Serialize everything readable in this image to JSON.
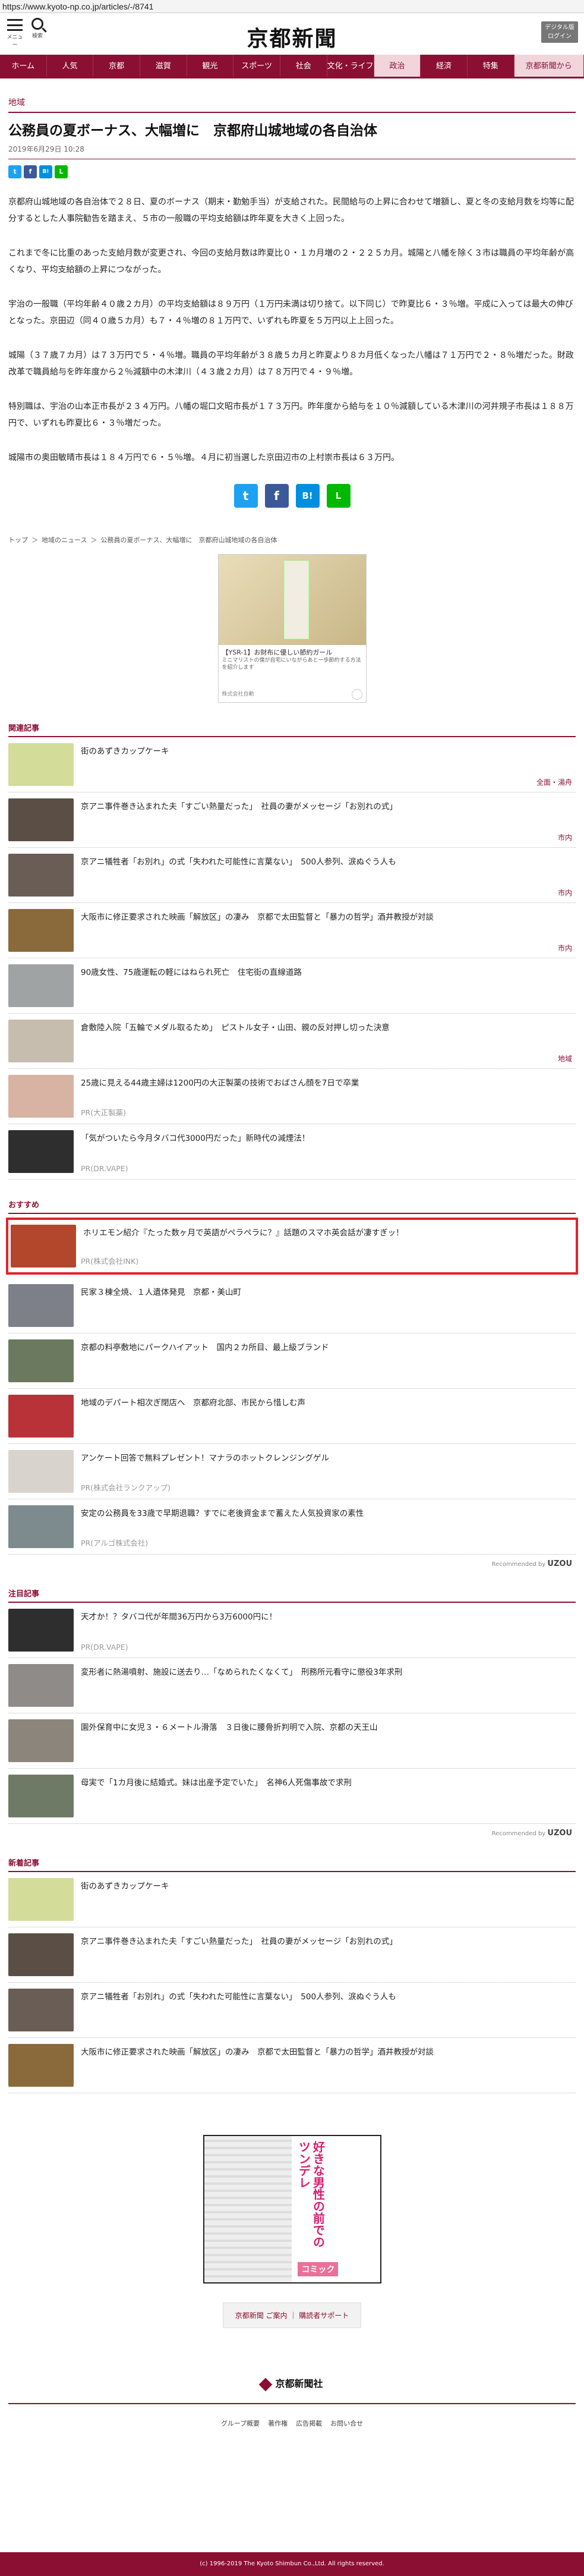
{
  "browser": {
    "url": "https://www.kyoto-np.co.jp/articles/-/8741"
  },
  "header": {
    "menu_label": "メニュー",
    "search_label": "検索",
    "logo": "京都新聞",
    "digital_btn": "デジタル版\nログイン"
  },
  "nav": {
    "items": [
      "ホーム",
      "人気",
      "京都",
      "滋賀",
      "観光",
      "スポーツ",
      "社会",
      "文化・ライフ",
      "政治",
      "経済",
      "特集",
      "京都新聞から"
    ],
    "selected_index": 8
  },
  "article": {
    "category": "地域",
    "title": "公務員の夏ボーナス、大幅増に　京都府山城地域の各自治体",
    "date": "2019年6月29日 10:28",
    "paragraphs": [
      "京都府山城地域の各自治体で２８日、夏のボーナス（期末・勤勉手当）が支給された。民間給与の上昇に合わせて増額し、夏と冬の支給月数を均等に配分するとした人事院勧告を踏まえ、５市の一般職の平均支給額は昨年夏を大きく上回った。",
      "これまで冬に比重のあった支給月数が変更され、今回の支給月数は昨夏比０・１カ月増の２・２２５カ月。城陽と八幡を除く３市は職員の平均年齢が高くなり、平均支給額の上昇につながった。",
      "宇治の一般職（平均年齢４０歳２カ月）の平均支給額は８９万円（１万円未満は切り捨て。以下同じ）で昨夏比６・３％増。平成に入っては最大の伸びとなった。京田辺（同４０歳５カ月）も７・４％増の８１万円で、いずれも昨夏を５万円以上上回った。",
      "城陽（３７歳７カ月）は７３万円で５・４％増。職員の平均年齢が３８歳５カ月と昨夏より８カ月低くなった八幡は７１万円で２・８％増だった。財政改革で職員給与を昨年度から２％減額中の木津川（４３歳２カ月）は７８万円で４・９％増。",
      "特別職は、宇治の山本正市長が２３４万円。八幡の堀口文昭市長が１７３万円。昨年度から給与を１０％減額している木津川の河井規子市長は１８８万円で、いずれも昨夏比６・３％増だった。",
      "城陽市の奥田敏晴市長は１８４万円で６・５％増。４月に初当選した京田辺市の上村崇市長は６３万円。"
    ]
  },
  "share": {
    "small": [
      "t",
      "f",
      "B!",
      "L"
    ],
    "big": [
      "t",
      "f",
      "B!",
      "L"
    ],
    "colors": {
      "twitter": "#1da1f2",
      "facebook": "#3b5998",
      "hatena": "#008fde",
      "line": "#00b900"
    }
  },
  "breadcrumb": [
    "トップ",
    "＞",
    "地域のニュース",
    "＞",
    "公務員の夏ボーナス、大幅増に　京都府山城地域の各自治体"
  ],
  "ad": {
    "text": "【YSR-1】お財布に優しい節約ガール",
    "sub": "ミニマリストの僕が自宅にいながらあと一歩節約する方法を紹介します",
    "source": "株式会社自動"
  },
  "related": {
    "heading": "関連記事",
    "items": [
      {
        "text": "街のあずきカップケーキ",
        "tag": "全面・湯舟",
        "thumb": "#d4dc9a"
      },
      {
        "text": "京アニ事件巻き込まれた夫「すごい熱量だった」　社員の妻がメッセージ「お別れの式」",
        "tag": "市内",
        "thumb": "#5b4e44"
      },
      {
        "text": "京アニ犠牲者「お別れ」の式「失われた可能性に言葉ない」　500人参列、涙ぬぐう人も",
        "tag": "市内",
        "thumb": "#6a5d55"
      },
      {
        "text": "大阪市に修正要求された映画「解放区」の凄み　京都で太田監督と「暴力の哲学」酒井教授が対談",
        "tag": "市内",
        "thumb": "#8a6a3a"
      },
      {
        "text": "90歳女性、75歳運転の軽にはねられ死亡　住宅街の直線道路",
        "tag": "",
        "thumb": "#a0a3a4"
      },
      {
        "text": "倉敷陸入院「五輪でメダル取るため」　ピストル女子・山田、親の反対押し切った決意",
        "tag": "地域",
        "thumb": "#c7bdaf"
      },
      {
        "text": "25歳に見える44歳主婦は1200円の大正製薬の技術でおばさん顔を7日で卒業",
        "pr": "PR(大正製薬)",
        "thumb": "#d8b2a2"
      },
      {
        "text": "「気がついたら今月タバコ代3000円だった」新時代の減煙法！",
        "pr": "PR(DR.VAPE)",
        "thumb": "#2e2e2e"
      }
    ]
  },
  "recommend": {
    "heading": "おすすめ",
    "items": [
      {
        "text": "ホリエモン紹介『たった数ヶ月で英語がペラペラに？』話題のスマホ英会話が凄すぎッ！",
        "pr": "PR(株式会社INK)",
        "thumb": "#b3472b",
        "highlight": true
      },
      {
        "text": "民家３棟全焼、１人遺体発見　京都・美山町",
        "thumb": "#7d8089"
      },
      {
        "text": "京都の料亭敷地にパークハイアット　国内２カ所目、最上級ブランド",
        "thumb": "#6b7a5e"
      },
      {
        "text": "地域のデパート相次ぎ閉店へ　京都府北部、市民から惜しむ声",
        "thumb": "#b83238"
      },
      {
        "text": "アンケート回答で無料プレゼント！マナラのホットクレンジングゲル",
        "pr": "PR(株式会社ランクアップ)",
        "thumb": "#d9d3ce"
      },
      {
        "text": "安定の公務員を33歳で早期退職？すでに老後資金まで蓄えた人気投資家の素性",
        "pr": "PR(アルゴ株式会社)",
        "thumb": "#7d8a8e"
      }
    ],
    "by": "Recommended by",
    "by_brand": "UZOU"
  },
  "attention": {
    "heading": "注目記事",
    "items": [
      {
        "text": "天才か！？タバコ代が年間36万円から3万6000円に！",
        "pr": "PR(DR.VAPE)",
        "thumb": "#2e2e2e"
      },
      {
        "text": "変形者に熱湯噴射、施設に送去り…「なめられたくなくて」　刑務所元看守に懲役3年求刑",
        "thumb": "#8f8b88"
      },
      {
        "text": "園外保育中に女児３・６メートル滑落　３日後に腰骨折判明で入院、京都の天王山",
        "thumb": "#8b857c"
      },
      {
        "text": "母実で「1カ月後に結婚式。妹は出産予定でいた」　名神6人死傷事故で求刑",
        "thumb": "#6f7a66"
      }
    ],
    "by": "Recommended by",
    "by_brand": "UZOU"
  },
  "latest": {
    "heading": "新着記事",
    "items": [
      {
        "text": "街のあずきカップケーキ",
        "thumb": "#d4dc9a"
      },
      {
        "text": "京アニ事件巻き込まれた夫「すごい熱量だった」　社員の妻がメッセージ「お別れの式」",
        "thumb": "#5b4e44"
      },
      {
        "text": "京アニ犠牲者「お別れ」の式「失われた可能性に言葉ない」　500人参列、涙ぬぐう人も",
        "thumb": "#6a5d55"
      },
      {
        "text": "大阪市に修正要求された映画「解放区」の凄み　京都で太田監督と「暴力の哲学」酒井教授が対談",
        "thumb": "#8a6a3a"
      }
    ]
  },
  "banner": {
    "title": "好きな男性の前でのツンデレ",
    "cta": "コミック"
  },
  "footer": {
    "links_box": [
      "京都新聞 ご案内",
      "｜",
      "購読者サポート"
    ],
    "logo": "京都新聞社",
    "links": [
      "グループ概要",
      "著作権",
      "広告掲載",
      "お問い合せ"
    ],
    "copyright": "(c) 1996-2019 The Kyoto Shimbun Co.,Ltd. All rights reserved."
  }
}
